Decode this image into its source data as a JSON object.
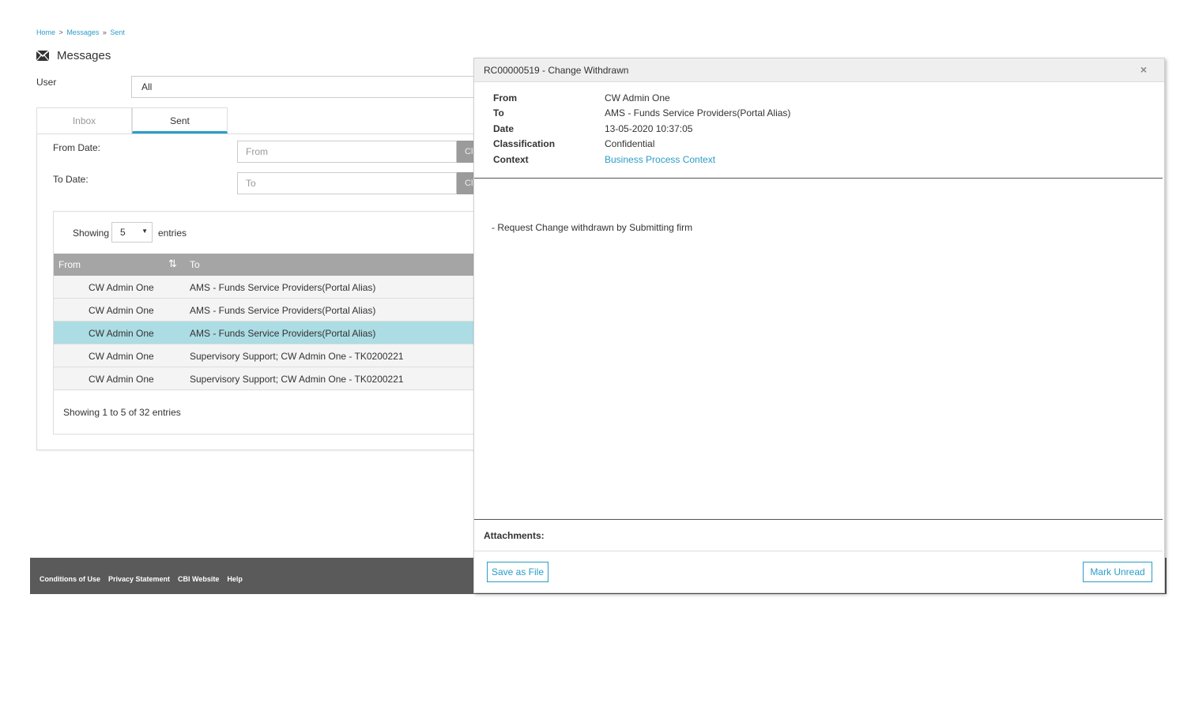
{
  "breadcrumb": {
    "home": "Home",
    "messages": "Messages",
    "sent": "Sent",
    "sep1": ">",
    "sep2": "»"
  },
  "page": {
    "title": "Messages",
    "icon": "envelope-icon"
  },
  "filters": {
    "user_label": "User",
    "user_value": "All",
    "from_date_label": "From Date:",
    "from_placeholder": "From",
    "to_date_label": "To Date:",
    "to_placeholder": "To",
    "clear_label": "Cl"
  },
  "tabs": [
    {
      "label": "Inbox",
      "active": false
    },
    {
      "label": "Sent",
      "active": true
    }
  ],
  "table": {
    "showing_label": "Showing",
    "entries_value": "5",
    "entries_label": "entries",
    "columns": [
      "From",
      "To"
    ],
    "rows": [
      {
        "from": "CW Admin One",
        "to": "AMS - Funds Service Providers(Portal Alias)",
        "selected": false
      },
      {
        "from": "CW Admin One",
        "to": "AMS - Funds Service Providers(Portal Alias)",
        "selected": false
      },
      {
        "from": "CW Admin One",
        "to": "AMS - Funds Service Providers(Portal Alias)",
        "selected": true
      },
      {
        "from": "CW Admin One",
        "to": "Supervisory Support; CW Admin One - TK0200221",
        "selected": false
      },
      {
        "from": "CW Admin One",
        "to": "Supervisory Support; CW Admin One - TK0200221",
        "selected": false
      }
    ],
    "info": "Showing 1 to 5 of 32 entries"
  },
  "footer": {
    "links": [
      "Conditions of Use",
      "Privacy Statement",
      "CBI Website",
      "Help"
    ]
  },
  "modal": {
    "title": "RC00000519 - Change Withdrawn",
    "close": "×",
    "meta": {
      "from_label": "From",
      "from_value": "CW Admin One",
      "to_label": "To",
      "to_value": "AMS - Funds Service Providers(Portal Alias)",
      "date_label": "Date",
      "date_value": "13-05-2020 10:37:05",
      "classification_label": "Classification",
      "classification_value": "Confidential",
      "context_label": "Context",
      "context_value": "Business Process Context"
    },
    "body": "- Request Change withdrawn by Submitting firm",
    "attachments_label": "Attachments:",
    "save_button": "Save as File",
    "mark_unread_button": "Mark Unread"
  },
  "colors": {
    "accent": "#2a9dc9",
    "selected_row": "#acdce4",
    "header_gray": "#a5a5a5",
    "footer": "#5a5a5a"
  }
}
